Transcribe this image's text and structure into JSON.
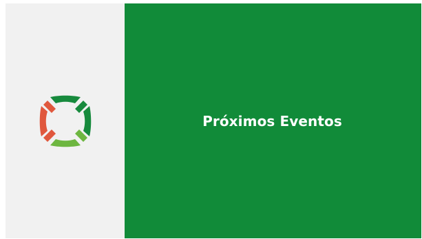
{
  "colors": {
    "left_panel_bg": "#f1f1f1",
    "right_panel_bg": "#118b39",
    "logo_dark_green": "#178a3d",
    "logo_light_green": "#6db640",
    "logo_red": "#e0583d",
    "heading_text": "#ffffff"
  },
  "logo": {
    "icon": "lifebuoy-logo-icon"
  },
  "content": {
    "heading": "Próximos Eventos"
  }
}
